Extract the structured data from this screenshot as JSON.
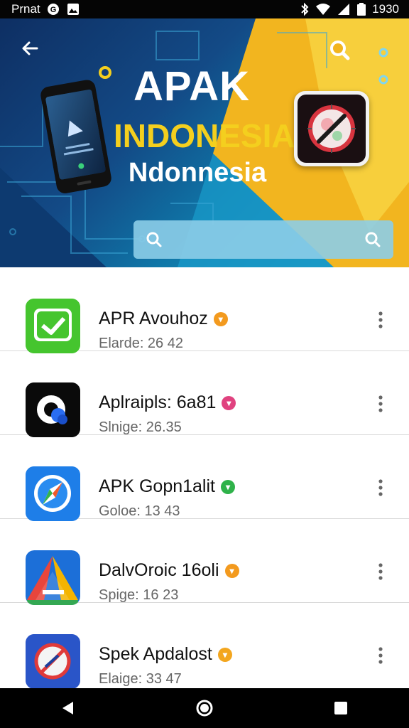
{
  "status_bar": {
    "carrier": "Prnat",
    "time": "1930",
    "icons": [
      "vpn-icon",
      "image-icon",
      "bluetooth-icon",
      "wifi-icon",
      "signal-icon",
      "battery-icon"
    ]
  },
  "hero": {
    "title_line1": "APAK",
    "title_line2": "INDONESIA",
    "title_line3": "Ndonnesia",
    "search_placeholder": "",
    "colors": {
      "yellow": "#f4cf1e",
      "blue_dark": "#0e2f63",
      "blue_light": "#1f9fc2"
    }
  },
  "apps": [
    {
      "name": "APR Avouhoz",
      "sub": "Elarde: 26 42",
      "badge_color": "#f39a1e",
      "badge_glyph": "▾",
      "icon": "check-chat-icon",
      "icon_bg": "#3fbd2a"
    },
    {
      "name": "Aplraipls: 6a81",
      "sub": "Slnige: 26.35",
      "badge_color": "#e0427f",
      "badge_glyph": "▾",
      "icon": "circle-logo-icon",
      "icon_bg": "#0a0a0a"
    },
    {
      "name": "APK Gopn1alit",
      "sub": "Goloe: 13 43",
      "badge_color": "#2fb24a",
      "badge_glyph": "▾",
      "icon": "compass-icon",
      "icon_bg": "#1e7ee8"
    },
    {
      "name": "DalvOroic 16oli",
      "sub": "Spige: 16 23",
      "badge_color": "#f39a1e",
      "badge_glyph": "▾",
      "icon": "triangle-logo-icon",
      "icon_bg": "#ffffff"
    },
    {
      "name": "Spek Apdalost",
      "sub": "Elaige: 33 47",
      "badge_color": "#f3a61e",
      "badge_glyph": "▾",
      "icon": "no-entry-compass-icon",
      "icon_bg": "#2a55c8"
    }
  ],
  "nav": {
    "icons": [
      "back-triangle-icon",
      "home-circle-icon",
      "recents-square-icon"
    ]
  }
}
